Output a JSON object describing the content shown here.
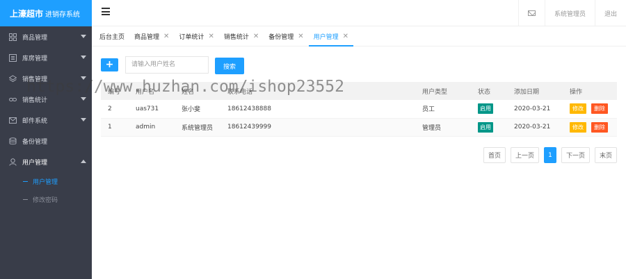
{
  "app": {
    "brand": "上濠超市",
    "subtitle": "进销存系统"
  },
  "sidebar": {
    "items": [
      {
        "label": "商品管理",
        "icon": "grid-icon",
        "arrow": "down"
      },
      {
        "label": "库房管理",
        "icon": "list-icon",
        "arrow": "down"
      },
      {
        "label": "销售管理",
        "icon": "layers-icon",
        "arrow": "down"
      },
      {
        "label": "销售统计",
        "icon": "link-icon",
        "arrow": "down"
      },
      {
        "label": "邮件系统",
        "icon": "mail-icon",
        "arrow": "down"
      },
      {
        "label": "备份管理",
        "icon": "database-icon",
        "arrow": ""
      },
      {
        "label": "用户管理",
        "icon": "user-icon",
        "arrow": "up"
      }
    ],
    "sub_items": [
      {
        "label": "用户管理",
        "active": true
      },
      {
        "label": "修改密码",
        "active": false
      }
    ]
  },
  "header": {
    "mail_icon": "mail-icon",
    "user": "系统管理员",
    "logout": "退出"
  },
  "tabs": [
    {
      "label": "后台主页",
      "closable": false
    },
    {
      "label": "商品管理",
      "closable": true
    },
    {
      "label": "订单统计",
      "closable": true
    },
    {
      "label": "销售统计",
      "closable": true
    },
    {
      "label": "备份管理",
      "closable": true
    },
    {
      "label": "用户管理",
      "closable": true,
      "active": true
    }
  ],
  "toolbar": {
    "add_label": "+",
    "search_placeholder": "请输入用户姓名",
    "search_label": "搜索"
  },
  "table": {
    "columns": [
      "编号",
      "用户名",
      "姓名",
      "联系电话",
      "",
      "",
      "用户类型",
      "状态",
      "添加日期",
      "操作"
    ],
    "rows": [
      {
        "id": "2",
        "username": "uas731",
        "name": "张小斐",
        "phone": "18612438888",
        "type": "员工",
        "status": "启用",
        "date": "2020-03-21",
        "edit": "修改",
        "delete": "删除"
      },
      {
        "id": "1",
        "username": "admin",
        "name": "系统管理员",
        "phone": "18612439999",
        "type": "管理员",
        "status": "启用",
        "date": "2020-03-21",
        "edit": "修改",
        "delete": "删除"
      }
    ]
  },
  "pager": {
    "first": "首页",
    "prev": "上一页",
    "current": "1",
    "next": "下一页",
    "last": "末页"
  },
  "watermark": "https://www.huzhan.com/ishop23552",
  "colors": {
    "accent": "#1e9fff",
    "sidebar_bg": "#393d49",
    "status": "#009688",
    "edit": "#ffb800",
    "delete": "#ff5722"
  }
}
